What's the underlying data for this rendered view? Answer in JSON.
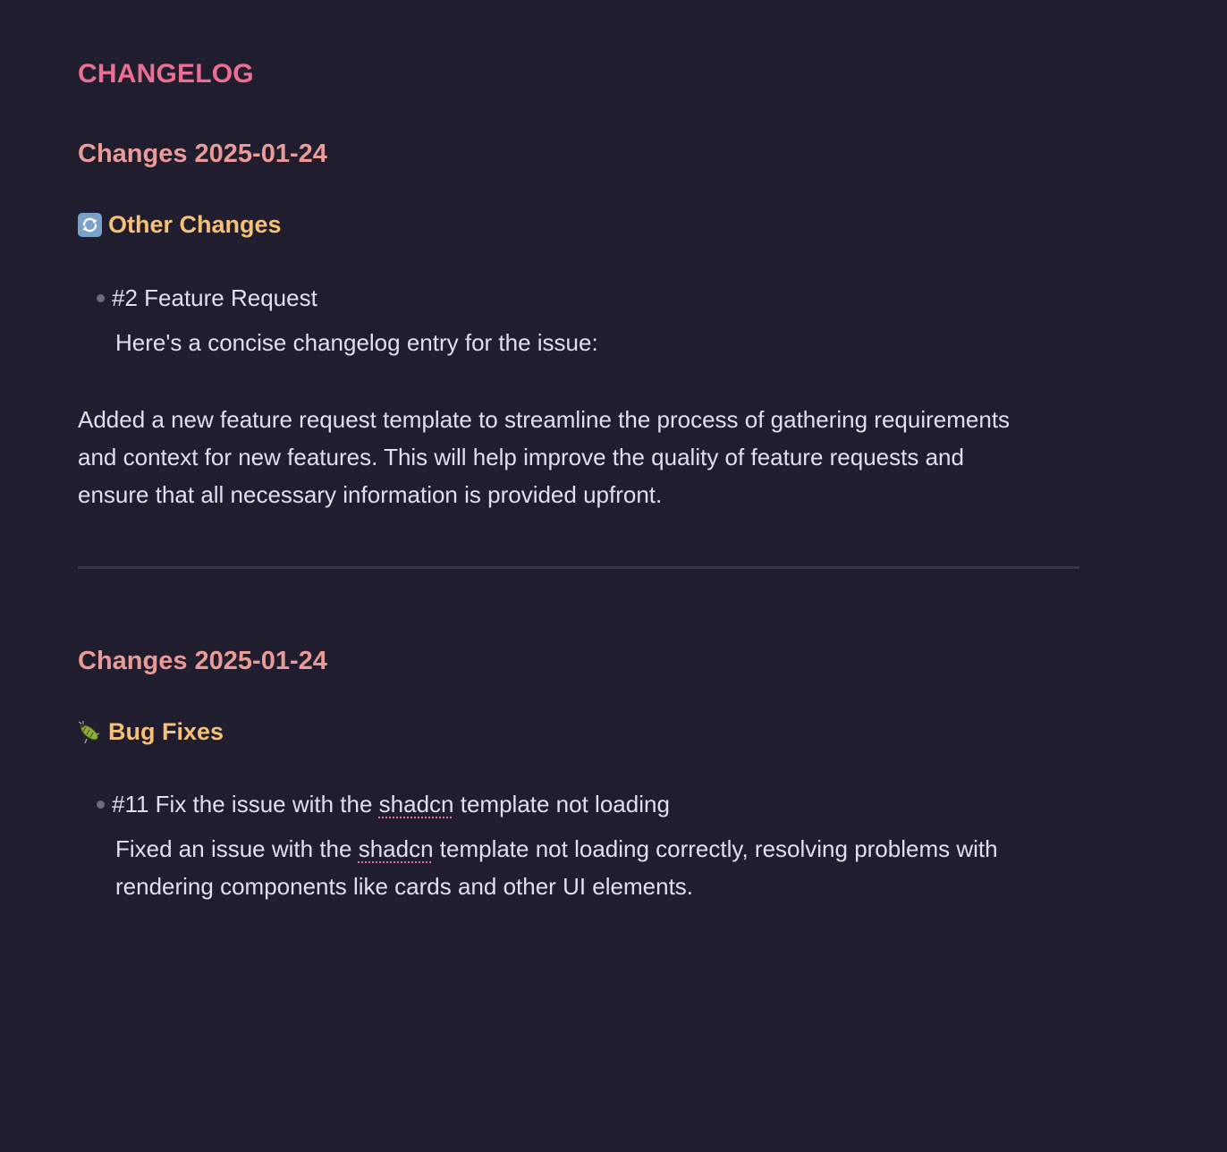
{
  "title": "CHANGELOG",
  "sections": [
    {
      "date_heading": "Changes 2025-01-24",
      "category_icon": "cycle-arrows-icon",
      "category": "Other Changes",
      "items": [
        {
          "title": "#2 Feature Request",
          "description": "Here's a concise changelog entry for the issue:"
        }
      ],
      "paragraph": "Added a new feature request template to streamline the process of gathering requirements and context for new features. This will help improve the quality of feature requests and ensure that all necessary information is provided upfront."
    },
    {
      "date_heading": "Changes 2025-01-24",
      "category_icon": "bug-icon",
      "category": "Bug Fixes",
      "items": [
        {
          "title_prefix": "#11 Fix the issue with the ",
          "title_flagged": "shadcn",
          "title_suffix": " template not loading",
          "desc_prefix": "Fixed an issue with the ",
          "desc_flagged": "shadcn",
          "desc_suffix": " template not loading correctly, resolving problems with rendering components like cards and other UI elements."
        }
      ]
    }
  ],
  "colors": {
    "background": "#1f1d2e",
    "title": "#eb6f92",
    "date_heading": "#ea9a97",
    "category": "#f6c177",
    "text": "#e0def4",
    "divider": "#393552"
  }
}
